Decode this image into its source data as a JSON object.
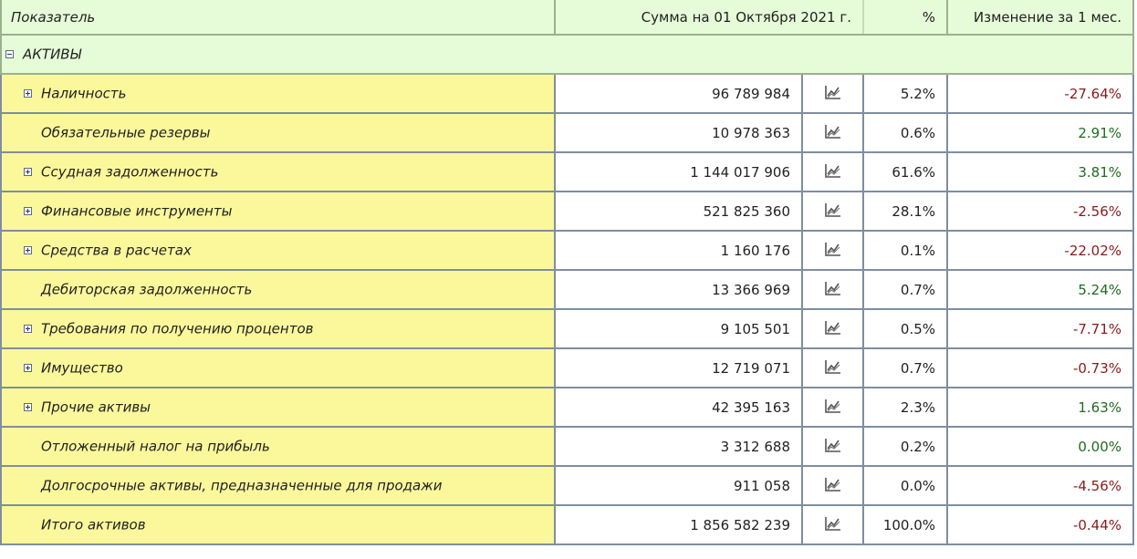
{
  "header": {
    "col_name": "Показатель",
    "col_sum": "Сумма на 01 Октября 2021 г.",
    "col_pct": "%",
    "col_change": "Изменение за 1 мес."
  },
  "section": {
    "label": "АКТИВЫ",
    "toggle": "minus"
  },
  "icons": {
    "chart": "line-chart-icon",
    "expand": "plus-toggle-icon",
    "collapse": "minus-toggle-icon"
  },
  "colors": {
    "header_bg": "#e6fcd8",
    "label_bg": "#fbf89c",
    "negative": "#8b1a1a",
    "positive": "#1f6b1f",
    "border": "#7f8ea0"
  },
  "rows": [
    {
      "name": "Наличность",
      "expandable": true,
      "value": "96 789 984",
      "pct": "5.2%",
      "change": "-27.64%"
    },
    {
      "name": "Обязательные резервы",
      "expandable": false,
      "value": "10 978 363",
      "pct": "0.6%",
      "change": "2.91%"
    },
    {
      "name": "Ссудная задолженность",
      "expandable": true,
      "value": "1 144 017 906",
      "pct": "61.6%",
      "change": "3.81%"
    },
    {
      "name": "Финансовые инструменты",
      "expandable": true,
      "value": "521 825 360",
      "pct": "28.1%",
      "change": "-2.56%"
    },
    {
      "name": "Средства в расчетах",
      "expandable": true,
      "value": "1 160 176",
      "pct": "0.1%",
      "change": "-22.02%"
    },
    {
      "name": "Дебиторская задолженность",
      "expandable": false,
      "value": "13 366 969",
      "pct": "0.7%",
      "change": "5.24%"
    },
    {
      "name": "Требования по получению процентов",
      "expandable": true,
      "value": "9 105 501",
      "pct": "0.5%",
      "change": "-7.71%"
    },
    {
      "name": "Имущество",
      "expandable": true,
      "value": "12 719 071",
      "pct": "0.7%",
      "change": "-0.73%"
    },
    {
      "name": "Прочие активы",
      "expandable": true,
      "value": "42 395 163",
      "pct": "2.3%",
      "change": "1.63%"
    },
    {
      "name": "Отложенный налог на прибыль",
      "expandable": false,
      "value": "3 312 688",
      "pct": "0.2%",
      "change": "0.00%"
    },
    {
      "name": "Долгосрочные активы, предназначенные для продажи",
      "expandable": false,
      "value": "911 058",
      "pct": "0.0%",
      "change": "-4.56%"
    },
    {
      "name": "Итого активов",
      "expandable": false,
      "value": "1 856 582 239",
      "pct": "100.0%",
      "change": "-0.44%"
    }
  ]
}
